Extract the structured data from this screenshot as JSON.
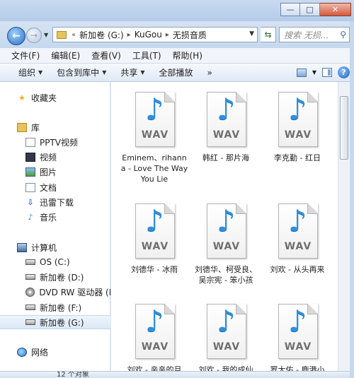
{
  "window": {
    "minimize": "—",
    "maximize": "□",
    "close": "✕"
  },
  "address": {
    "prefix": "«",
    "crumbs": [
      "新加卷 (G:)",
      "KuGou",
      "无损音质"
    ],
    "separator": "▸",
    "search_placeholder": "搜索 无损..."
  },
  "menu": {
    "items": [
      "文件(F)",
      "编辑(E)",
      "查看(V)",
      "工具(T)",
      "帮助(H)"
    ]
  },
  "commands": {
    "organize": "组织",
    "include": "包含到库中",
    "share": "共享",
    "play_all": "全部播放",
    "more": "»",
    "help": "?"
  },
  "nav": {
    "favorites": "收藏夹",
    "library": "库",
    "pptv": "PPTV视频",
    "video": "视频",
    "pictures": "图片",
    "documents": "文档",
    "xunlei": "迅雷下载",
    "music": "音乐",
    "computer": "计算机",
    "drive_c": "OS (C:)",
    "drive_d": "新加卷 (D:)",
    "dvd": "DVD RW 驱动器 (E",
    "drive_f": "新加卷 (F:)",
    "drive_g": "新加卷 (G:)",
    "network": "网络"
  },
  "files": {
    "type_label": "WAV",
    "items": [
      "Eminem、rihanna - Love The Way You Lie",
      "韩红 - 那片海",
      "李克勤 - 红日",
      "刘德华 - 冰雨",
      "刘德华、柯受良、吴宗宪 - 笨小孩",
      "刘欢 - 从头再来",
      "刘欢 - 亲亲的月",
      "刘欢 - 我的成仙",
      "罗大佑 - 鹿港小"
    ]
  },
  "status": {
    "count": "12 个对象"
  }
}
